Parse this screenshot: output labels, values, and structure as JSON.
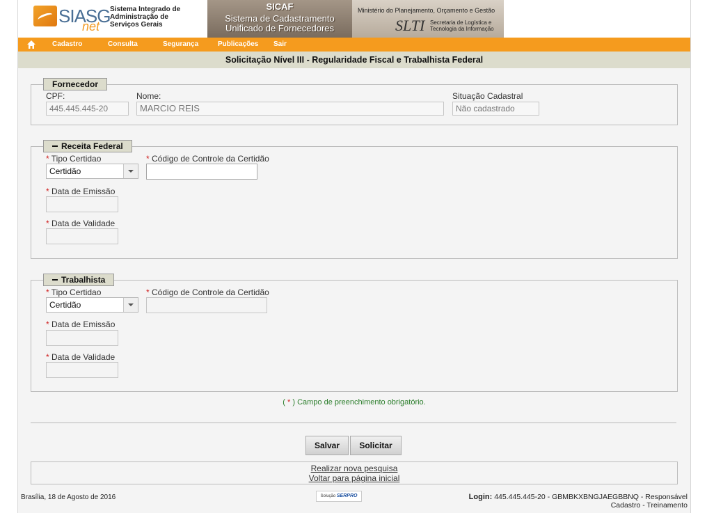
{
  "banner": {
    "logo_text": "SIASG",
    "logo_net": "net",
    "logo_desc": "Sistema Integrado de Administração de Serviços Gerais",
    "sicaf_title": "SICAF",
    "sicaf_sub": "Sistema de Cadastramento Unificado de Fornecedores",
    "ministry": "Ministério do Planejamento, Orçamento e Gestão",
    "slti": "SLTI",
    "slti_desc": "Secretaria de Logística e Tecnologia da Informação"
  },
  "menu": {
    "home_icon": "home-icon",
    "items": [
      "Cadastro",
      "Consulta",
      "Segurança",
      "Publicações",
      "Sair"
    ]
  },
  "page_title": "Solicitação Nível III - Regularidade Fiscal e Trabalhista Federal",
  "fornecedor": {
    "legend": "Fornecedor",
    "cpf_label": "CPF:",
    "cpf_value": "445.445.445-20",
    "nome_label": "Nome:",
    "nome_value": "MARCIO REIS",
    "situacao_label": "Situação Cadastral",
    "situacao_value": "Não cadastrado"
  },
  "receita": {
    "legend": "Receita Federal",
    "tipo_label": "Tipo Certidao",
    "tipo_value": "Certidão",
    "codigo_label": "Código de Controle da Certidão",
    "codigo_value": "",
    "emissao_label": "Data de Emissão",
    "validade_label": "Data de Validade"
  },
  "trabalhista": {
    "legend": "Trabalhista",
    "tipo_label": "Tipo Certidao",
    "tipo_value": "Certidão",
    "codigo_label": "Código de Controle da Certidão",
    "codigo_value": "",
    "emissao_label": "Data de Emissão",
    "validade_label": "Data de Validade"
  },
  "required_mark": "*",
  "note": {
    "open": "(",
    "star": "*",
    "text": ") Campo de preenchimento obrigatório."
  },
  "buttons": {
    "salvar": "Salvar",
    "solicitar": "Solicitar"
  },
  "links": {
    "nova_pesquisa": "Realizar nova pesquisa",
    "pagina_inicial": "Voltar para página inicial"
  },
  "footer": {
    "date": "Brasília, 18 de Agosto de 2016",
    "serpro_small": "Solução",
    "serpro_brand": "SERPRO",
    "login_label": "Login:",
    "login_value": "445.445.445-20 - GBMBKXBNGJAEGBBNQ - Responsável",
    "login_line2": "Cadastro - Treinamento"
  },
  "colors": {
    "menu_bar": "#f59b1e",
    "title_bar": "#dcdccc",
    "required": "#d02020",
    "note": "#2a7d2a"
  }
}
